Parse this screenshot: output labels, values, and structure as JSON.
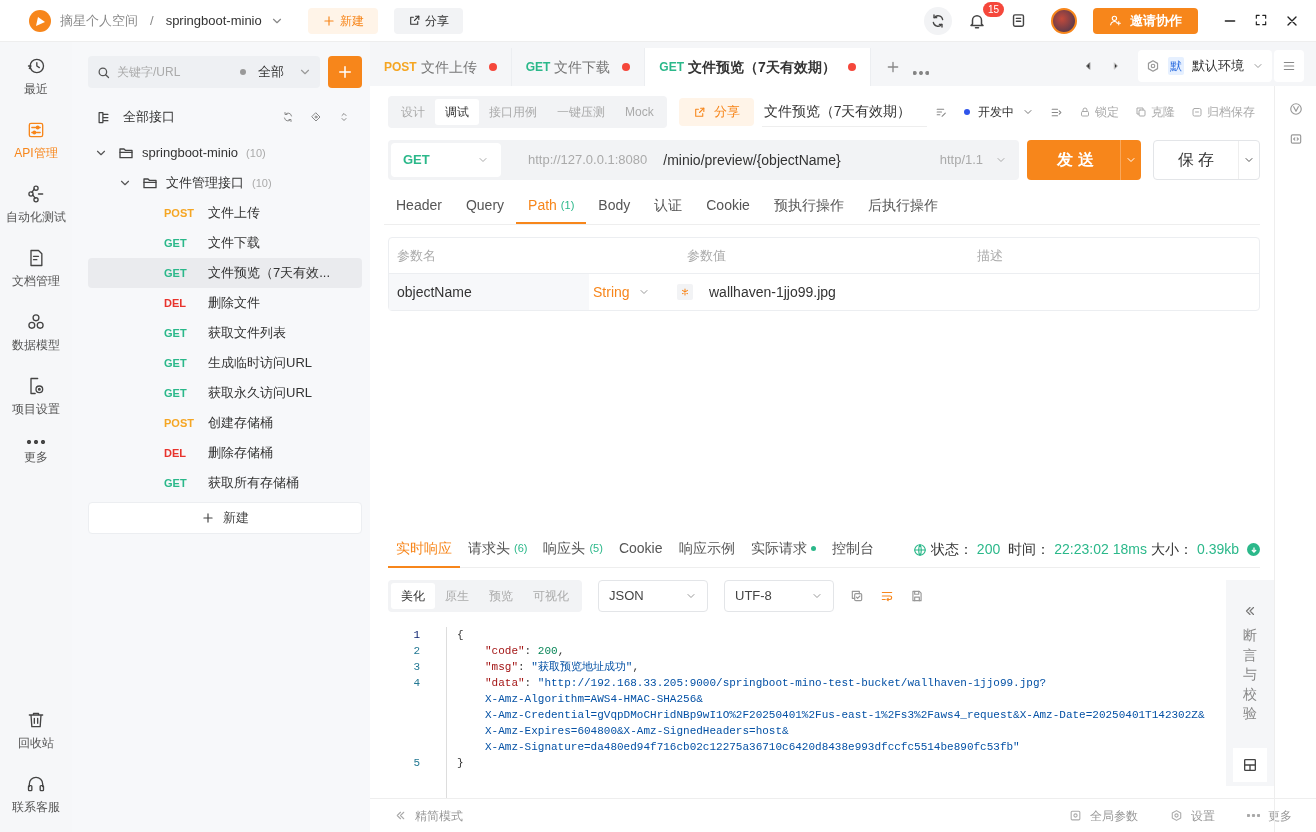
{
  "titlebar": {
    "workspace": "摘星个人空间",
    "separator": "/",
    "project": "springboot-minio",
    "new_button": "新建",
    "share_button": "分享",
    "notification_count": "15",
    "invite_button": "邀请协作"
  },
  "rail": {
    "items": [
      {
        "label": "最近",
        "selected": false
      },
      {
        "label": "API管理",
        "selected": true
      },
      {
        "label": "自动化测试",
        "selected": false
      },
      {
        "label": "文档管理",
        "selected": false
      },
      {
        "label": "数据模型",
        "selected": false
      },
      {
        "label": "项目设置",
        "selected": false
      },
      {
        "label": "更多",
        "selected": false
      }
    ],
    "bottom_items": [
      {
        "label": "回收站"
      },
      {
        "label": "联系客服"
      }
    ]
  },
  "sidebar": {
    "search": {
      "placeholder": "关键字/URL"
    },
    "filter": "全部",
    "root": "全部接口",
    "new_button": "新建",
    "tree": [
      {
        "name": "springboot-minio",
        "count": "(10)",
        "expanded": true,
        "children": [
          {
            "name": "文件管理接口",
            "count": "(10)",
            "expanded": true,
            "children": [
              {
                "method": "POST",
                "color": "#f5a623",
                "name": "文件上传",
                "selected": false
              },
              {
                "method": "GET",
                "color": "#2bb88a",
                "name": "文件下载",
                "selected": false
              },
              {
                "method": "GET",
                "color": "#2bb88a",
                "name": "文件预览（7天有效...",
                "selected": true
              },
              {
                "method": "DEL",
                "color": "#e8332c",
                "name": "删除文件",
                "selected": false
              },
              {
                "method": "GET",
                "color": "#2bb88a",
                "name": "获取文件列表",
                "selected": false
              },
              {
                "method": "GET",
                "color": "#2bb88a",
                "name": "生成临时访问URL",
                "selected": false
              },
              {
                "method": "GET",
                "color": "#2bb88a",
                "name": "获取永久访问URL",
                "selected": false
              },
              {
                "method": "POST",
                "color": "#f5a623",
                "name": "创建存储桶",
                "selected": false
              },
              {
                "method": "DEL",
                "color": "#e8332c",
                "name": "删除存储桶",
                "selected": false
              },
              {
                "method": "GET",
                "color": "#2bb88a",
                "name": "获取所有存储桶",
                "selected": false
              }
            ]
          }
        ]
      }
    ]
  },
  "tabs": [
    {
      "method": "POST",
      "color": "#f5a623",
      "title": "文件上传",
      "selected": false,
      "unsaved": true
    },
    {
      "method": "GET",
      "color": "#2bb88a",
      "title": "文件下载",
      "selected": false,
      "unsaved": true
    },
    {
      "method": "GET",
      "color": "#2bb88a",
      "title": "文件预览（7天有效期）",
      "selected": true,
      "unsaved": true
    }
  ],
  "environment": {
    "badge": "默",
    "name": "默认环境"
  },
  "toolbar": {
    "modes": [
      {
        "label": "设计",
        "selected": false
      },
      {
        "label": "调试",
        "selected": true
      },
      {
        "label": "接口用例",
        "selected": false
      },
      {
        "label": "一键压测",
        "selected": false
      },
      {
        "label": "Mock",
        "selected": false
      }
    ],
    "share": "分享",
    "name": "文件预览（7天有效期）",
    "status": {
      "label": "开发中",
      "color": "#2f54eb"
    },
    "actions": [
      "锁定",
      "克隆",
      "归档保存"
    ]
  },
  "request": {
    "method": "GET",
    "base_url": "http://127.0.0.1:8080",
    "path": "/minio/preview/{objectName}",
    "protocol": "http/1.1",
    "send": "发 送",
    "save": "保 存"
  },
  "param_tabs": [
    {
      "label": "Header",
      "selected": false
    },
    {
      "label": "Query",
      "selected": false
    },
    {
      "label": "Path",
      "count": "(1)",
      "selected": true
    },
    {
      "label": "Body",
      "selected": false
    },
    {
      "label": "认证",
      "selected": false
    },
    {
      "label": "Cookie",
      "selected": false
    },
    {
      "label": "预执行操作",
      "selected": false
    },
    {
      "label": "后执行操作",
      "selected": false
    }
  ],
  "params_table": {
    "columns": [
      "参数名",
      "参数值",
      "描述"
    ],
    "rows": [
      {
        "name": "objectName",
        "type": "String",
        "required": true,
        "value": "wallhaven-1jjo99.jpg"
      }
    ]
  },
  "response_tabs": [
    {
      "label": "实时响应",
      "selected": true
    },
    {
      "label": "请求头",
      "count": "(6)",
      "selected": false
    },
    {
      "label": "响应头",
      "count": "(5)",
      "selected": false
    },
    {
      "label": "Cookie",
      "selected": false
    },
    {
      "label": "响应示例",
      "selected": false
    },
    {
      "label": "实际请求",
      "selected": false,
      "dot": true
    },
    {
      "label": "控制台",
      "selected": false
    }
  ],
  "status": {
    "status_label": "状态：",
    "code": "200",
    "time_label": "时间：",
    "time": "22:23:02",
    "duration": "18ms",
    "size_label": "大小：",
    "size": "0.39kb"
  },
  "view_modes": [
    {
      "label": "美化",
      "selected": true
    },
    {
      "label": "原生",
      "selected": false
    },
    {
      "label": "预览",
      "selected": false
    },
    {
      "label": "可视化",
      "selected": false
    }
  ],
  "format": "JSON",
  "encoding": "UTF-8",
  "code_lines": [
    {
      "number": "1",
      "indented": false,
      "tokens": [
        {
          "kind": "punct",
          "text": "{"
        }
      ]
    },
    {
      "number": "2",
      "indented": true,
      "tokens": [
        {
          "kind": "key",
          "text": "\"code\""
        },
        {
          "kind": "punct",
          "text": ": "
        },
        {
          "kind": "number",
          "text": "200"
        },
        {
          "kind": "punct",
          "text": ","
        }
      ]
    },
    {
      "number": "3",
      "indented": true,
      "tokens": [
        {
          "kind": "key",
          "text": "\"msg\""
        },
        {
          "kind": "punct",
          "text": ": "
        },
        {
          "kind": "string",
          "text": "\"获取预览地址成功\""
        },
        {
          "kind": "punct",
          "text": ","
        }
      ]
    },
    {
      "number": "4",
      "indented": true,
      "tokens": [
        {
          "kind": "key",
          "text": "\"data\""
        },
        {
          "kind": "punct",
          "text": ": "
        },
        {
          "kind": "string",
          "text": "\"http://192.168.33.205:9000/springboot-mino-test-bucket/wallhaven-1jjo99.jpg?"
        }
      ],
      "wrapped": [
        "X-Amz-Algorithm=AWS4-HMAC-SHA256&",
        "X-Amz-Credential=gVqpDMoCHridNBp9wI1O%2F20250401%2Fus-east-1%2Fs3%2Faws4_request&X-Amz-Date=20250401T142302Z&",
        "X-Amz-Expires=604800&X-Amz-SignedHeaders=host&",
        "X-Amz-Signature=da480ed94f716cb02c12275a36710c6420d8438e993dfccfc5514be890fc53fb\""
      ]
    },
    {
      "number": "5",
      "indented": false,
      "tokens": [
        {
          "kind": "punct",
          "text": "}"
        }
      ]
    }
  ],
  "side_panel": {
    "label": "断言与校验"
  },
  "footer": {
    "compact_mode": "精简模式",
    "global_params": "全局参数",
    "settings": "设置",
    "more": "更多"
  }
}
